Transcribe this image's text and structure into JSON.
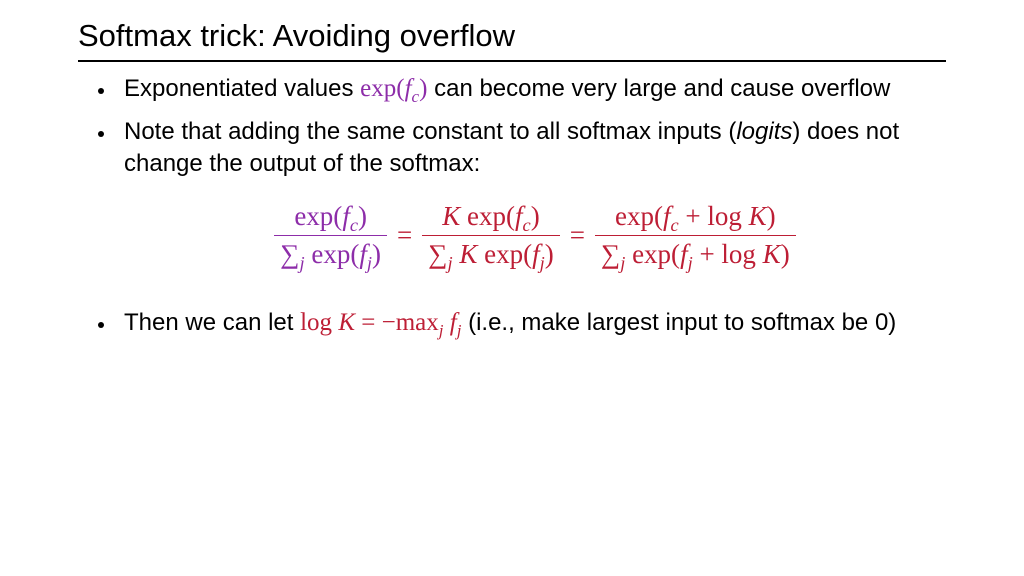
{
  "title": "Softmax trick: Avoiding overflow",
  "b1": {
    "pre": "Exponentiated values ",
    "math_exp": "exp(",
    "math_var": "f",
    "math_sub": "c",
    "math_close": ")",
    "post": " can become very large and cause overflow"
  },
  "b2": {
    "pre": "Note that adding the same constant to all softmax inputs (",
    "logits": "logits",
    "post": ") does not change the output of the softmax:"
  },
  "eq": {
    "f1_num_exp": "exp(",
    "f1_num_var": "f",
    "f1_num_sub": "c",
    "f1_num_close": ")",
    "f1_den_sum": "∑",
    "f1_den_sumsub": "j",
    "f1_den_exp": " exp(",
    "f1_den_var": "f",
    "f1_den_varsub": "j",
    "f1_den_close": ")",
    "eq1": "=",
    "f2_num_K": "K",
    "f2_num_exp": " exp(",
    "f2_num_var": "f",
    "f2_num_sub": "c",
    "f2_num_close": ")",
    "f2_den_sum": "∑",
    "f2_den_sumsub": "j",
    "f2_den_K": " K",
    "f2_den_exp": " exp(",
    "f2_den_var": "f",
    "f2_den_varsub": "j",
    "f2_den_close": ")",
    "eq2": "=",
    "f3_num_exp": "exp(",
    "f3_num_var": "f",
    "f3_num_sub": "c",
    "f3_num_plus": " + log ",
    "f3_num_K": "K",
    "f3_num_close": ")",
    "f3_den_sum": "∑",
    "f3_den_sumsub": "j",
    "f3_den_exp": " exp(",
    "f3_den_var": "f",
    "f3_den_varsub": "j",
    "f3_den_plus": " + log ",
    "f3_den_K": "K",
    "f3_den_close": ")"
  },
  "b3": {
    "pre": "Then we can let ",
    "m_log": "log ",
    "m_K": "K",
    "m_eq": " = −",
    "m_max": "max",
    "m_maxsub": "j",
    "m_sp": " ",
    "m_f": "f",
    "m_fsub": "j",
    "post": " (i.e., make largest input to softmax be 0)"
  }
}
